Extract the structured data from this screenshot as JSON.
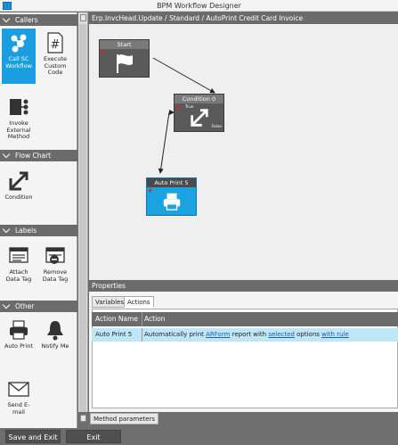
{
  "window": {
    "title": "BPM Workflow Designer"
  },
  "left_panel": {
    "sections": [
      {
        "label": "Callers",
        "tools": [
          {
            "label": "Call SC Workflow",
            "icon": "call-sc-workflow-icon",
            "selected": true
          },
          {
            "label": "Execute Custom Code",
            "icon": "hash-code-icon",
            "selected": false
          },
          {
            "label": "Invoke External Method",
            "icon": "external-method-icon",
            "selected": false
          }
        ]
      },
      {
        "label": "Flow Chart",
        "tools": [
          {
            "label": "Condition",
            "icon": "condition-icon",
            "selected": false
          }
        ]
      },
      {
        "label": "Labels",
        "tools": [
          {
            "label": "Attach Data Tag",
            "icon": "attach-data-tag-icon",
            "selected": false
          },
          {
            "label": "Remove Data Tag",
            "icon": "remove-data-tag-icon",
            "selected": false
          }
        ]
      },
      {
        "label": "Other",
        "tools": [
          {
            "label": "Auto Print",
            "icon": "printer-icon",
            "selected": false
          },
          {
            "label": "Notify Me",
            "icon": "bell-icon",
            "selected": false
          },
          {
            "label": "Send E-mail",
            "icon": "envelope-icon",
            "selected": false
          }
        ]
      }
    ]
  },
  "canvas": {
    "breadcrumb": "Erp.InvcHead.Update / Standard / AutoPrint Credit Card Invoice",
    "nodes": [
      {
        "title": "Start",
        "icon": "flag-icon"
      },
      {
        "title": "Condition 0",
        "icon": "condition-icon",
        "true_label": "True",
        "false_label": "False"
      },
      {
        "title": "Auto Print 5",
        "icon": "printer-icon"
      }
    ]
  },
  "properties": {
    "header": "Properties",
    "tabs": [
      {
        "label": "Variables",
        "active": false
      },
      {
        "label": "Actions",
        "active": true
      }
    ],
    "columns": [
      "Action Name",
      "Action"
    ],
    "rows": [
      {
        "action_name": "Auto Print 5",
        "text_1": "Automatically print ",
        "link_1": "ARForm",
        "text_2": " report with ",
        "link_2": "selected",
        "text_3": " options ",
        "link_3": "with rule"
      }
    ],
    "method_parameters": "Method parameters"
  },
  "footer": {
    "save_exit": "Save and Exit",
    "exit": "Exit"
  },
  "colors": {
    "accent": "#1a9ee0",
    "header": "#6b6b6b",
    "row_highlight": "#bfe6f7",
    "link": "#1a5fb0"
  }
}
